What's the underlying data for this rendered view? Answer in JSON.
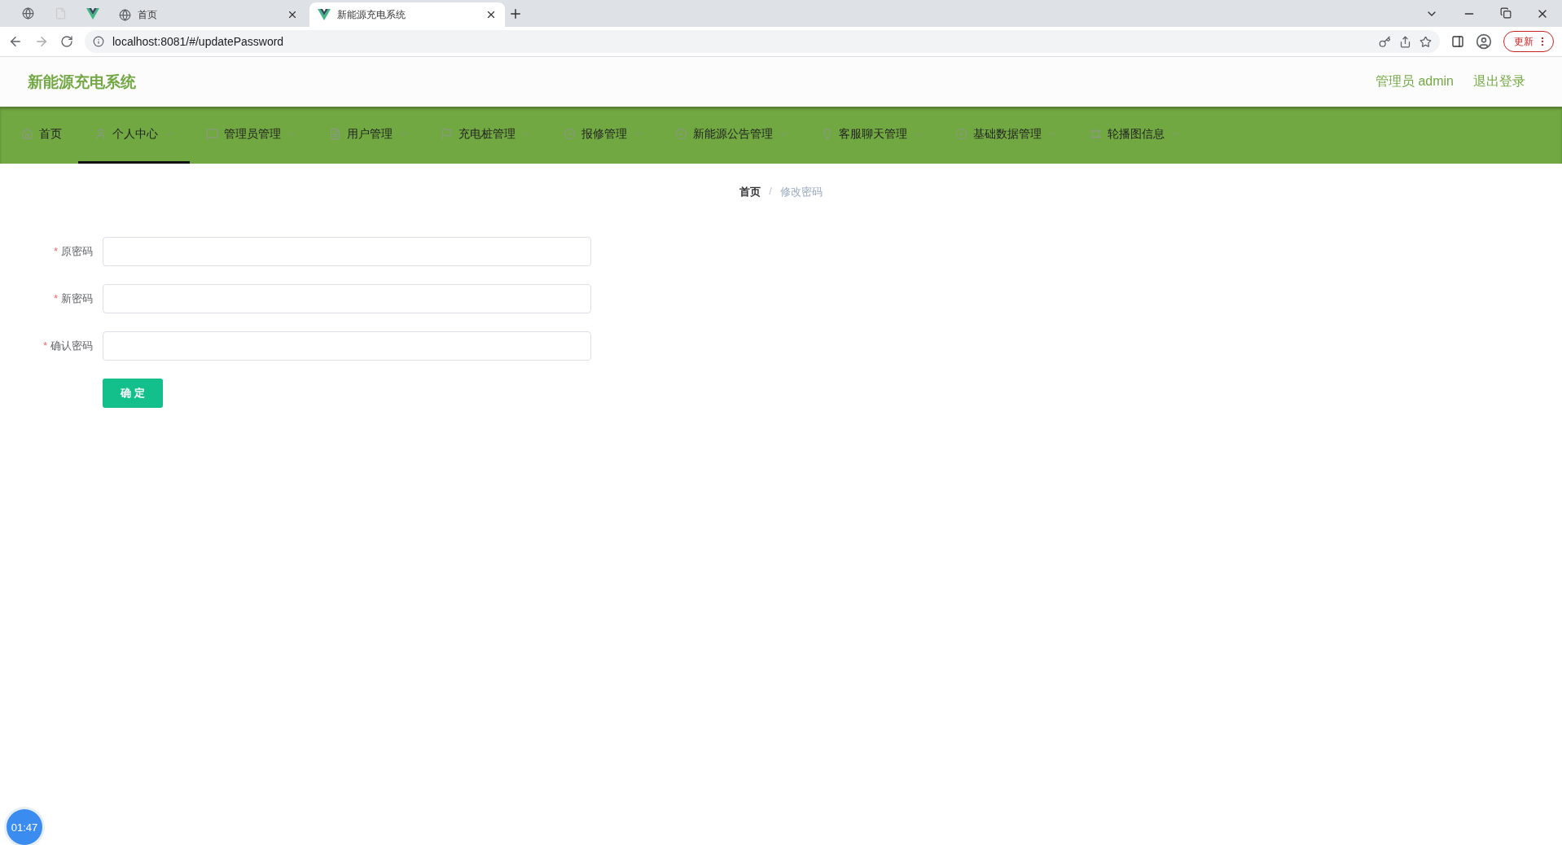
{
  "browser": {
    "tabs": [
      {
        "title": "首页",
        "selected": false
      },
      {
        "title": "新能源充电系统",
        "selected": true
      }
    ],
    "address": "localhost:8081/#/updatePassword",
    "update_button": "更新"
  },
  "header": {
    "title": "新能源充电系统",
    "user": "管理员 admin",
    "logout": "退出登录"
  },
  "nav": [
    {
      "label": "首页",
      "dropdown": false,
      "selected": false
    },
    {
      "label": "个人中心",
      "dropdown": true,
      "selected": true
    },
    {
      "label": "管理员管理",
      "dropdown": true,
      "selected": false
    },
    {
      "label": "用户管理",
      "dropdown": true,
      "selected": false
    },
    {
      "label": "充电桩管理",
      "dropdown": true,
      "selected": false
    },
    {
      "label": "报修管理",
      "dropdown": true,
      "selected": false
    },
    {
      "label": "新能源公告管理",
      "dropdown": true,
      "selected": false
    },
    {
      "label": "客服聊天管理",
      "dropdown": true,
      "selected": false
    },
    {
      "label": "基础数据管理",
      "dropdown": true,
      "selected": false
    },
    {
      "label": "轮播图信息",
      "dropdown": true,
      "selected": false
    }
  ],
  "breadcrumb": {
    "separator": "/",
    "items": [
      {
        "label": "首页",
        "current": false
      },
      {
        "label": "修改密码",
        "current": true
      }
    ]
  },
  "form": {
    "fields": [
      {
        "label": "原密码",
        "required_mark": "*"
      },
      {
        "label": "新密码",
        "required_mark": "*"
      },
      {
        "label": "确认密码",
        "required_mark": "*"
      }
    ],
    "submit": "确 定"
  },
  "timer": "01:47"
}
